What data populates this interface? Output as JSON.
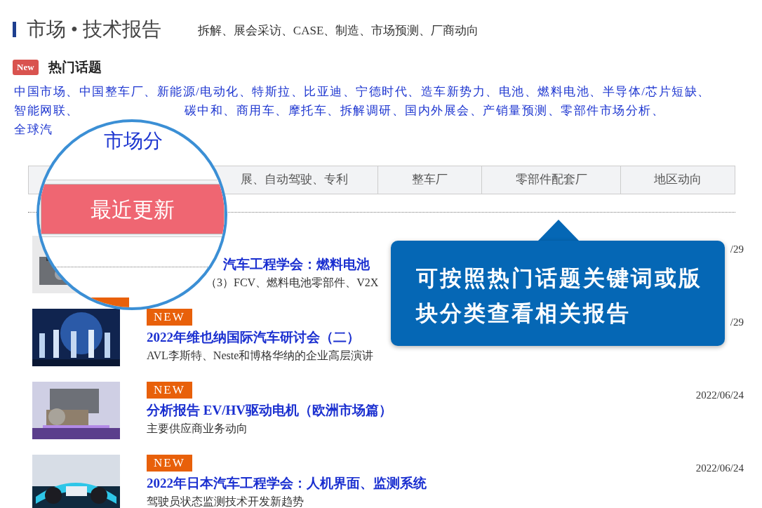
{
  "header": {
    "title": "市场 • 技术报告",
    "subtitle": "拆解、展会采访、CASE、制造、市场预测、厂商动向"
  },
  "hot_topics": {
    "badge": "New",
    "title": "热门话题",
    "lines": [
      {
        "items": [
          "中国市场、",
          "中国整车厂、",
          "新能源/电动化、",
          "特斯拉、",
          "比亚迪、",
          "宁德时代、",
          "造车新势力、",
          "电池、",
          "燃料电池、",
          "半导体/芯片短缺、"
        ]
      },
      {
        "items": [
          "智能网联、"
        ],
        "items_after_magnifier": [
          "碳中和、",
          "商用车、",
          "摩托车、",
          "拆解调研、",
          "国内外展会、",
          "产销量预测、",
          "零部件市场分析、"
        ]
      },
      {
        "items": [
          "全球汽"
        ]
      }
    ]
  },
  "tabs": [
    {
      "label": "展、自动驾驶、专利",
      "selected": false
    },
    {
      "label": "整车厂",
      "selected": false
    },
    {
      "label": "零部件配套厂",
      "selected": false
    },
    {
      "label": "地区动向",
      "selected": false
    }
  ],
  "magnifier": {
    "text": "市场分",
    "tab": {
      "label": "最近更新",
      "selected": true
    }
  },
  "reports": [
    {
      "title": "汽车工程学会：燃料电池",
      "subtitle": "（3）FCV、燃料电池零部件、V2X",
      "date": "/29"
    },
    {
      "badge": "NEW",
      "title": "2022年维也纳国际汽车研讨会（二）",
      "subtitle": "AVL李斯特、Neste和博格华纳的企业高层演讲",
      "date": "/29"
    },
    {
      "badge": "NEW",
      "title": "分析报告 EV/HV驱动电机（欧洲市场篇）",
      "subtitle": "主要供应商业务动向",
      "date": "2022/06/24"
    },
    {
      "badge": "NEW",
      "title": "2022年日本汽车工程学会：人机界面、监测系统",
      "subtitle": "驾驶员状态监测技术开发新趋势",
      "date": "2022/06/24"
    }
  ],
  "tooltip": {
    "text": "可按照热门话题关键词或版块分类查看相关报告"
  }
}
